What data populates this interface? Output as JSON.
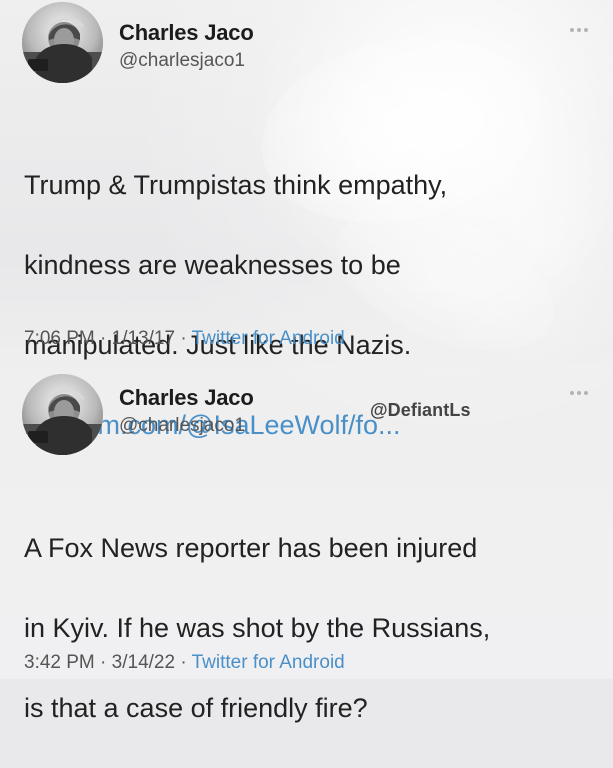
{
  "tweets": [
    {
      "name": "Charles Jaco",
      "handle": "@charlesjaco1",
      "body_lines": [
        "Trump & Trumpistas think empathy,",
        "kindness are weaknesses to be",
        "manipulated. Just like the Nazis."
      ],
      "link_text": "medium.com/@IsaLeeWolf/fo...",
      "time": "7:06 PM",
      "date": "1/13/17",
      "source": "Twitter for Android"
    },
    {
      "name": "Charles Jaco",
      "handle": "@charlesjaco1",
      "watermark": "@DefiantLs",
      "body_lines": [
        "A Fox News reporter has been injured",
        "in Kyiv. If he was shot by the Russians,",
        "is that a case of friendly fire?"
      ],
      "time": "3:42 PM",
      "date": "3/14/22",
      "source": "Twitter for Android"
    }
  ],
  "colors": {
    "link": "#4a90c8",
    "text": "#222222",
    "muted": "#555555",
    "background": "#e9e9eb"
  },
  "icons": {
    "more": "more-icon",
    "avatar": "avatar-photo"
  },
  "separator": "·"
}
